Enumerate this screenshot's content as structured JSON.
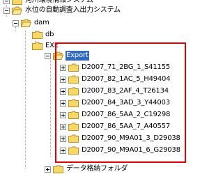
{
  "tree": {
    "nodes": [
      {
        "key": "n0",
        "label": "河川環境情報システム",
        "expander": "minus",
        "selected": false
      },
      {
        "key": "n1",
        "label": "水位の自動調査入出力システム",
        "expander": "minus",
        "selected": false
      },
      {
        "key": "n2",
        "label": "dam",
        "expander": "minus",
        "selected": false
      },
      {
        "key": "n3",
        "label": "db",
        "expander": "none",
        "selected": false
      },
      {
        "key": "n4",
        "label": "EXE",
        "expander": "none",
        "selected": false
      },
      {
        "key": "n5",
        "label": "Export",
        "expander": "minus",
        "selected": true
      },
      {
        "key": "n6",
        "label": "D2007_71_2BG_1_S41155",
        "expander": "plus",
        "selected": false
      },
      {
        "key": "n7",
        "label": "D2007_82_1AC_5_H49404",
        "expander": "plus",
        "selected": false
      },
      {
        "key": "n8",
        "label": "D2007_83_2AF_4_T26134",
        "expander": "plus",
        "selected": false
      },
      {
        "key": "n9",
        "label": "D2007_84_3AD_3_Y44003",
        "expander": "plus",
        "selected": false
      },
      {
        "key": "n10",
        "label": "D2007_86_5AA_2_C19298",
        "expander": "plus",
        "selected": false
      },
      {
        "key": "n11",
        "label": "D2007_86_5AA_7_A40557",
        "expander": "plus",
        "selected": false
      },
      {
        "key": "n12",
        "label": "D2007_90_M9A01_3_D29038",
        "expander": "plus",
        "selected": false
      },
      {
        "key": "n13",
        "label": "D2007_90_M9A01_6_G29038",
        "expander": "plus",
        "selected": false
      },
      {
        "key": "n14",
        "label": "データ格納フォルダ",
        "expander": "plus",
        "selected": false
      }
    ]
  },
  "highlight": {
    "color": "#e00000"
  },
  "colors": {
    "folder_fill": "#f7d867",
    "folder_stroke": "#b8902a",
    "selection": "#316ac5"
  }
}
